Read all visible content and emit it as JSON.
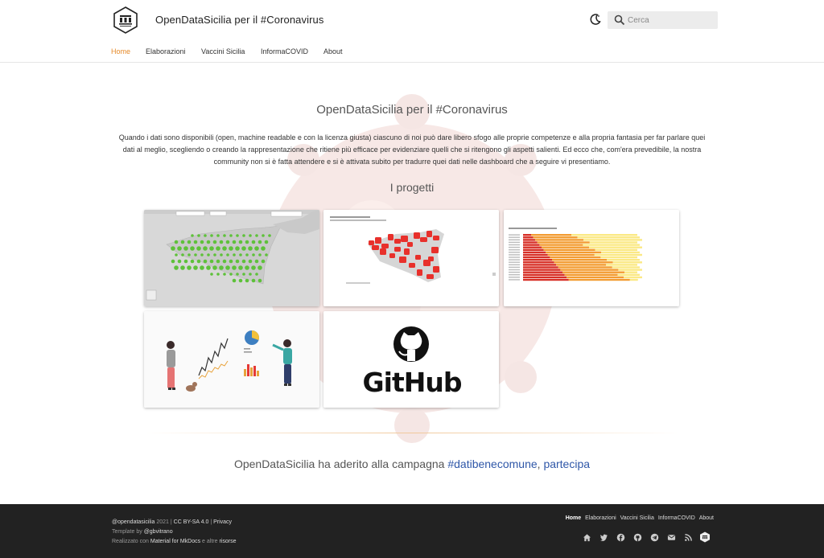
{
  "header": {
    "site_title": "OpenDataSicilia per il #Coronavirus",
    "search_placeholder": "Cerca"
  },
  "tabs": [
    {
      "label": "Home",
      "active": true
    },
    {
      "label": "Elaborazioni"
    },
    {
      "label": "Vaccini Sicilia"
    },
    {
      "label": "InformaCOVID"
    },
    {
      "label": "About"
    }
  ],
  "main": {
    "title": "OpenDataSicilia per il #Coronavirus",
    "intro": "Quando i dati sono disponibili (open, machine readable e con la licenza giusta) ciascuno di noi può dare libero sfogo alle proprie competenze e alla propria fantasia per far parlare quei dati al meglio, scegliendo o creando la rappresentazione che ritiene più efficace per evidenziare quelli che si ritengono gli aspetti salienti. Ed ecco che, com'era prevedibile, la nostra community non si è fatta attendere e si è attivata subito per tradurre quei dati nelle dashboard che a seguire vi presentiamo.",
    "projects_title": "I progetti",
    "cards": [
      {
        "name": "map-green-dots"
      },
      {
        "name": "map-red-municipalities"
      },
      {
        "name": "bar-chart-stacked"
      },
      {
        "name": "illustration-analytics"
      },
      {
        "name": "github",
        "text": "GitHub"
      }
    ],
    "campaign_prefix": "OpenDataSicilia ha aderito alla campagna ",
    "campaign_link": "#datibenecomune",
    "campaign_sep": ", ",
    "campaign_link2": "partecipa"
  },
  "footer": {
    "handle": "@opendatasicilia",
    "year": "2021",
    "license": "CC BY-SA 4.0",
    "privacy": "Privacy",
    "template_prefix": "Template by ",
    "template_author": "@gbvitrano",
    "made_prefix": "Realizzato con ",
    "made_tool": "Material for MkDocs",
    "made_mid": " e altre ",
    "made_resources": "risorse",
    "nav": [
      "Home",
      "Elaborazioni",
      "Vaccini Sicilia",
      "InformaCOVID",
      "About"
    ],
    "icons": [
      "home-icon",
      "twitter-icon",
      "facebook-icon",
      "github-icon",
      "telegram-icon",
      "email-icon",
      "rss-icon",
      "opendatasicilia-icon"
    ]
  },
  "colors": {
    "accent": "#e58a2a",
    "link": "#2f57a8",
    "footer_bg": "#222222"
  }
}
